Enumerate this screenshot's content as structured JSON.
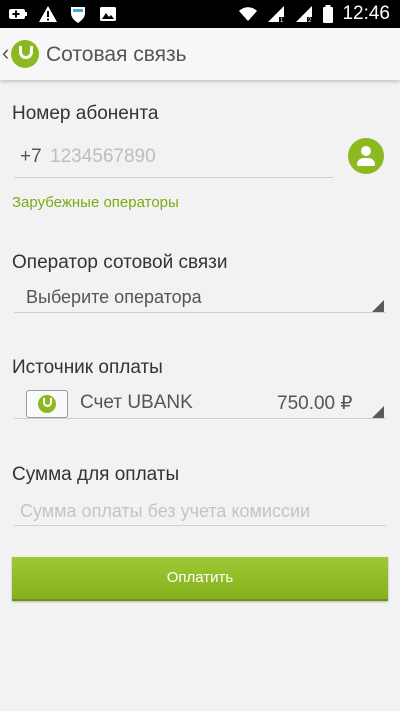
{
  "status_bar": {
    "time": "12:46",
    "left_icons": [
      "battery-plus-icon",
      "warning-icon",
      "shield-icon",
      "image-icon"
    ],
    "right_icons": [
      "wifi-icon",
      "signal-1-icon",
      "signal-2-icon",
      "battery-icon"
    ]
  },
  "app_bar": {
    "back_glyph": "‹",
    "title": "Сотовая связь"
  },
  "subscriber": {
    "label": "Номер абонента",
    "prefix": "+7",
    "placeholder": "1234567890",
    "foreign_link": "Зарубежные операторы"
  },
  "operator": {
    "label": "Оператор сотовой связи",
    "selected": "Выберите оператора"
  },
  "payment_source": {
    "label": "Источник оплаты",
    "account_name": "Счет UBANK",
    "amount": "750.00 ₽"
  },
  "sum": {
    "label": "Сумма для оплаты",
    "placeholder": "Сумма оплаты без учета комиссии"
  },
  "pay_button": {
    "label": "Оплатить"
  },
  "colors": {
    "accent": "#8cb91f",
    "link": "#7bab14",
    "background": "#f2f2f2"
  }
}
